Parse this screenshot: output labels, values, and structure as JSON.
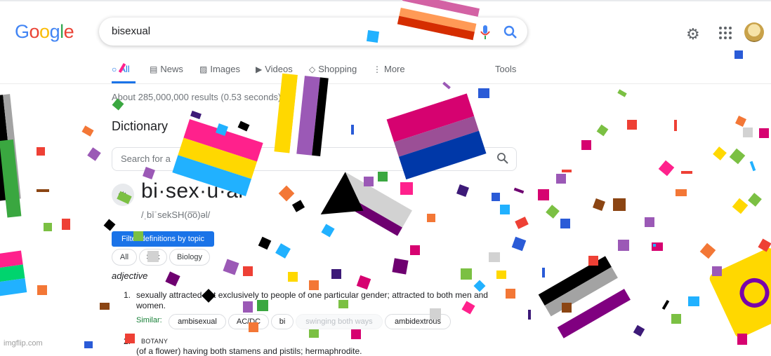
{
  "header": {
    "logo_text": "Google",
    "search_value": "bisexual",
    "brand_colors": [
      "#4285f4",
      "#ea4335",
      "#fbbc05",
      "#34a853"
    ]
  },
  "tabs": [
    {
      "label": "All",
      "icon": "search-icon",
      "active": true
    },
    {
      "label": "News",
      "icon": "news-icon"
    },
    {
      "label": "Images",
      "icon": "image-icon"
    },
    {
      "label": "Videos",
      "icon": "video-icon"
    },
    {
      "label": "Shopping",
      "icon": "tag-icon"
    },
    {
      "label": "More",
      "icon": "more-vertical-icon"
    }
  ],
  "tools_label": "Tools",
  "result_stats": "About 285,000,000 results (0.53 seconds)",
  "dictionary": {
    "title": "Dictionary",
    "search_placeholder": "Search for a",
    "headword": "bi·sex·u·al",
    "phonetic": "/ˌbīˈsekSH(o͞o)əl/",
    "filter_button": "Filter definitions by topic",
    "topic_chips": [
      "All",
      "Sex",
      "Biology"
    ],
    "part_of_speech": "adjective",
    "definitions": [
      {
        "number": "1.",
        "text": "sexually attracted not exclusively to people of one particular gender; attracted to both men and women.",
        "similar_label": "Similar:",
        "similar": [
          "ambisexual",
          "AC/DC",
          "bi",
          "swinging both ways",
          "ambidextrous"
        ]
      },
      {
        "number": "2.",
        "label": "BOTANY",
        "text": "(of a flower) having both stamens and pistils; hermaphrodite."
      }
    ]
  },
  "watermark": "imgflip.com",
  "overlay_colors": [
    "#d60270",
    "#9b4f96",
    "#0038a8",
    "#ffd800",
    "#21b1ff",
    "#ff218c",
    "#7bc043",
    "#3d1a78",
    "#ee4035",
    "#f37736"
  ]
}
